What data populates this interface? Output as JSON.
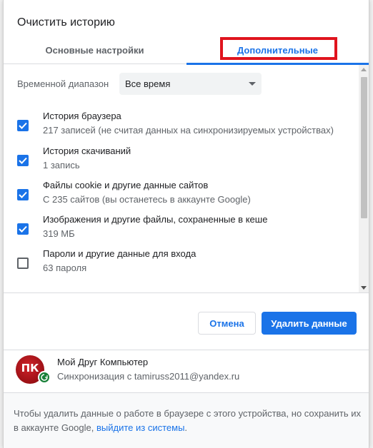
{
  "dialog": {
    "title": "Очистить историю"
  },
  "tabs": [
    {
      "label": "Основные настройки"
    },
    {
      "label": "Дополнительные"
    }
  ],
  "time_range": {
    "label": "Временной диапазон",
    "value": "Все время"
  },
  "items": [
    {
      "title": "История браузера",
      "subtitle": "217 записей (не считая данных на синхронизируемых устройствах)",
      "checked": true
    },
    {
      "title": "История скачиваний",
      "subtitle": "1 запись",
      "checked": true
    },
    {
      "title": "Файлы cookie и другие данные сайтов",
      "subtitle": "С 235 сайтов (вы останетесь в аккаунте Google)",
      "checked": true
    },
    {
      "title": "Изображения и другие файлы, сохраненные в кеше",
      "subtitle": "319 МБ",
      "checked": true
    },
    {
      "title": "Пароли и другие данные для входа",
      "subtitle": "63 пароля",
      "checked": false
    }
  ],
  "buttons": {
    "cancel": "Отмена",
    "delete": "Удалить данные"
  },
  "account": {
    "avatar_text": "ПК",
    "name": "Мой Друг Компьютер",
    "sync": "Синхронизация с tamiruss2011@yandex.ru"
  },
  "footer": {
    "text": "Чтобы удалить данные о работе в браузере с этого устройства, но сохранить их в аккаунте Google,",
    "link": "выйдите из системы",
    "end": "."
  },
  "colors": {
    "accent": "#1a73e8",
    "highlight": "#e0141e",
    "sync": "#188038"
  },
  "icons": {
    "checkbox_checked": "check-icon",
    "sync_badge": "sync-icon",
    "dropdown": "chevron-down-icon"
  }
}
